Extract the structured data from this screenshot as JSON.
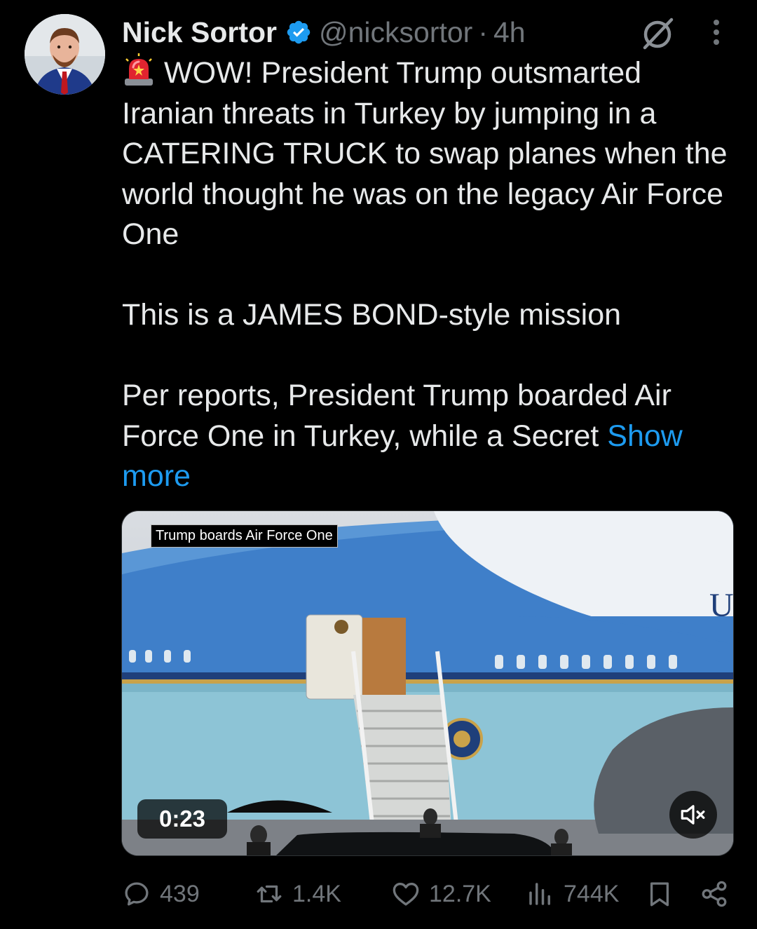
{
  "author": {
    "name": "Nick Sortor",
    "handle": "@nicksortor",
    "separator": "·",
    "time": "4h"
  },
  "icons": {
    "verified": "verified-badge-icon",
    "grok": "grok-icon",
    "more": "more-vertical-icon",
    "siren": "police-siren-emoji",
    "mute": "volume-muted-icon",
    "reply": "reply-icon",
    "retweet": "retweet-icon",
    "like": "heart-icon",
    "views": "analytics-icon",
    "bookmark": "bookmark-icon",
    "share": "share-icon"
  },
  "colors": {
    "background": "#000000",
    "text": "#e7e9ea",
    "secondary": "#71767b",
    "link": "#1d9bf0",
    "verified": "#1d9bf0"
  },
  "tweet": {
    "para1": "WOW! President Trump outsmarted Iranian threats in Turkey by jumping in a CATERING TRUCK to swap planes when the world thought he was on the legacy Air Force One",
    "para2": "This is a JAMES BOND-style mission",
    "para3": "Per reports, President Trump boarded Air Force One in Turkey, while a Secret",
    "show_more": "Show more"
  },
  "media": {
    "caption": "Trump boards Air Force One",
    "duration": "0:23"
  },
  "stats": {
    "replies": "439",
    "retweets": "1.4K",
    "likes": "12.7K",
    "views": "744K"
  }
}
